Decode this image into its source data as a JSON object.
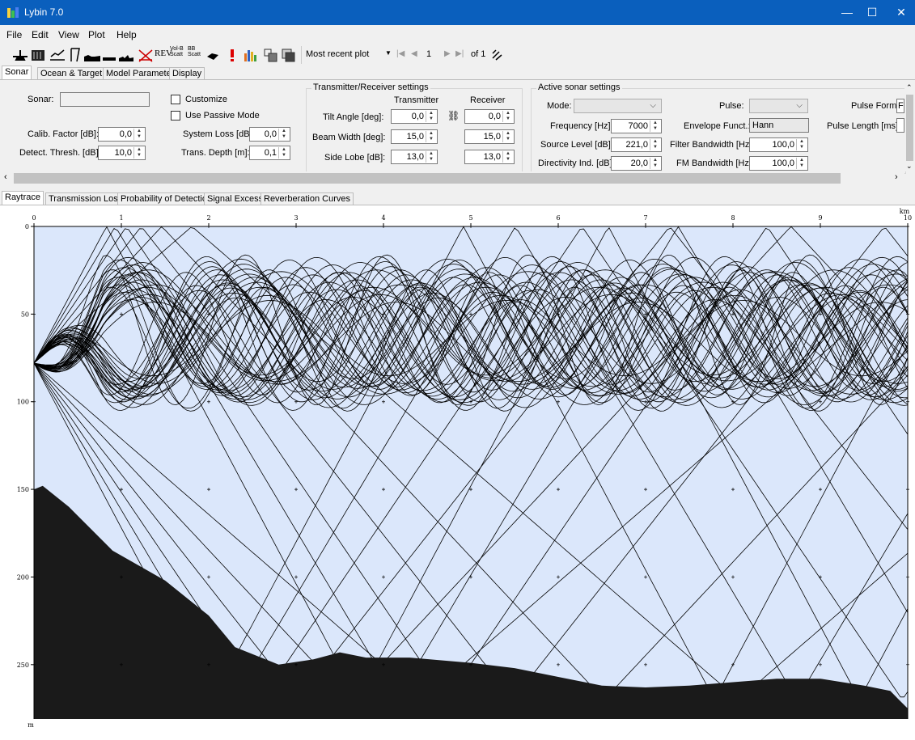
{
  "window": {
    "title": "Lybin 7.0",
    "min": "—",
    "max": "☐",
    "close": "✕"
  },
  "menu": [
    "File",
    "Edit",
    "View",
    "Plot",
    "Help"
  ],
  "toolbar": {
    "plot_select": "Most recent plot",
    "page": "1",
    "of": "of 1",
    "rev_label": "REV",
    "volb_label": "Vol-B",
    "scatt_label": "Scatt",
    "bb_label": "BB",
    "scatt2_label": "Scatt"
  },
  "tabs": [
    "Sonar",
    "Ocean & Target",
    "Model Parameters",
    "Display"
  ],
  "sonar": {
    "sonar_label": "Sonar:",
    "sonar_value": "",
    "calib_label": "Calib. Factor [dB]:",
    "calib_value": "0,0",
    "detect_label": "Detect. Thresh. [dB]:",
    "detect_value": "10,0",
    "customize_label": "Customize",
    "passive_label": "Use Passive Mode",
    "sysloss_label": "System Loss [dB]:",
    "sysloss_value": "0,0",
    "depth_label": "Trans. Depth [m]:",
    "depth_value": "0,1"
  },
  "txrx": {
    "group_title": "Transmitter/Receiver settings",
    "col_tx": "Transmitter",
    "col_rx": "Receiver",
    "tilt_label": "Tilt Angle [deg]:",
    "tilt_tx": "0,0",
    "tilt_rx": "0,0",
    "beam_label": "Beam Width [deg]:",
    "beam_tx": "15,0",
    "beam_rx": "15,0",
    "side_label": "Side Lobe [dB]:",
    "side_tx": "13,0",
    "side_rx": "13,0"
  },
  "active": {
    "group_title": "Active sonar settings",
    "mode_label": "Mode:",
    "mode_value": "",
    "freq_label": "Frequency [Hz]:",
    "freq_value": "7000",
    "source_label": "Source Level [dB]:",
    "source_value": "221,0",
    "dir_label": "Directivity Ind. [dB]:",
    "dir_value": "20,0",
    "pulse_label": "Pulse:",
    "pulse_value": "",
    "env_label": "Envelope Funct.:",
    "env_value": "Hann",
    "filter_label": "Filter Bandwidth [Hz]:",
    "filter_value": "100,0",
    "fm_label": "FM Bandwidth [Hz]:",
    "fm_value": "100,0",
    "pulseform_label": "Pulse Form:",
    "pulseform_value": "F",
    "pulselen_label": "Pulse Length [ms]:",
    "pulselen_value": ""
  },
  "plot_tabs": [
    "Raytrace",
    "Transmission Loss",
    "Probability of Detection",
    "Signal Excess",
    "Reverberation Curves"
  ],
  "chart_data": {
    "type": "raytrace",
    "x_unit": "km",
    "y_unit": "m",
    "x_ticks": [
      "0",
      "1",
      "2",
      "3",
      "4",
      "5",
      "6",
      "7",
      "8",
      "9",
      "10"
    ],
    "y_ticks": [
      "0",
      "50",
      "100",
      "150",
      "200",
      "250"
    ],
    "xlim": [
      0,
      10
    ],
    "ylim": [
      0,
      281
    ],
    "source_depth": 78,
    "bottom_profile": {
      "x": [
        0,
        0.1,
        0.4,
        0.9,
        1.5,
        2.0,
        2.3,
        2.8,
        3.2,
        3.5,
        3.8,
        4.3,
        5.0,
        5.5,
        6.0,
        6.5,
        7.0,
        7.5,
        8.0,
        8.5,
        9.0,
        9.5,
        9.8,
        9.9,
        10.0
      ],
      "y": [
        150,
        148,
        160,
        185,
        202,
        222,
        240,
        250,
        247,
        243,
        246,
        246,
        249,
        252,
        257,
        262,
        263,
        262,
        260,
        258,
        258,
        262,
        265,
        270,
        275
      ]
    },
    "water_color": "#dbe7fb",
    "bottom_color": "#1a1a1a",
    "ray_color": "#000000"
  }
}
